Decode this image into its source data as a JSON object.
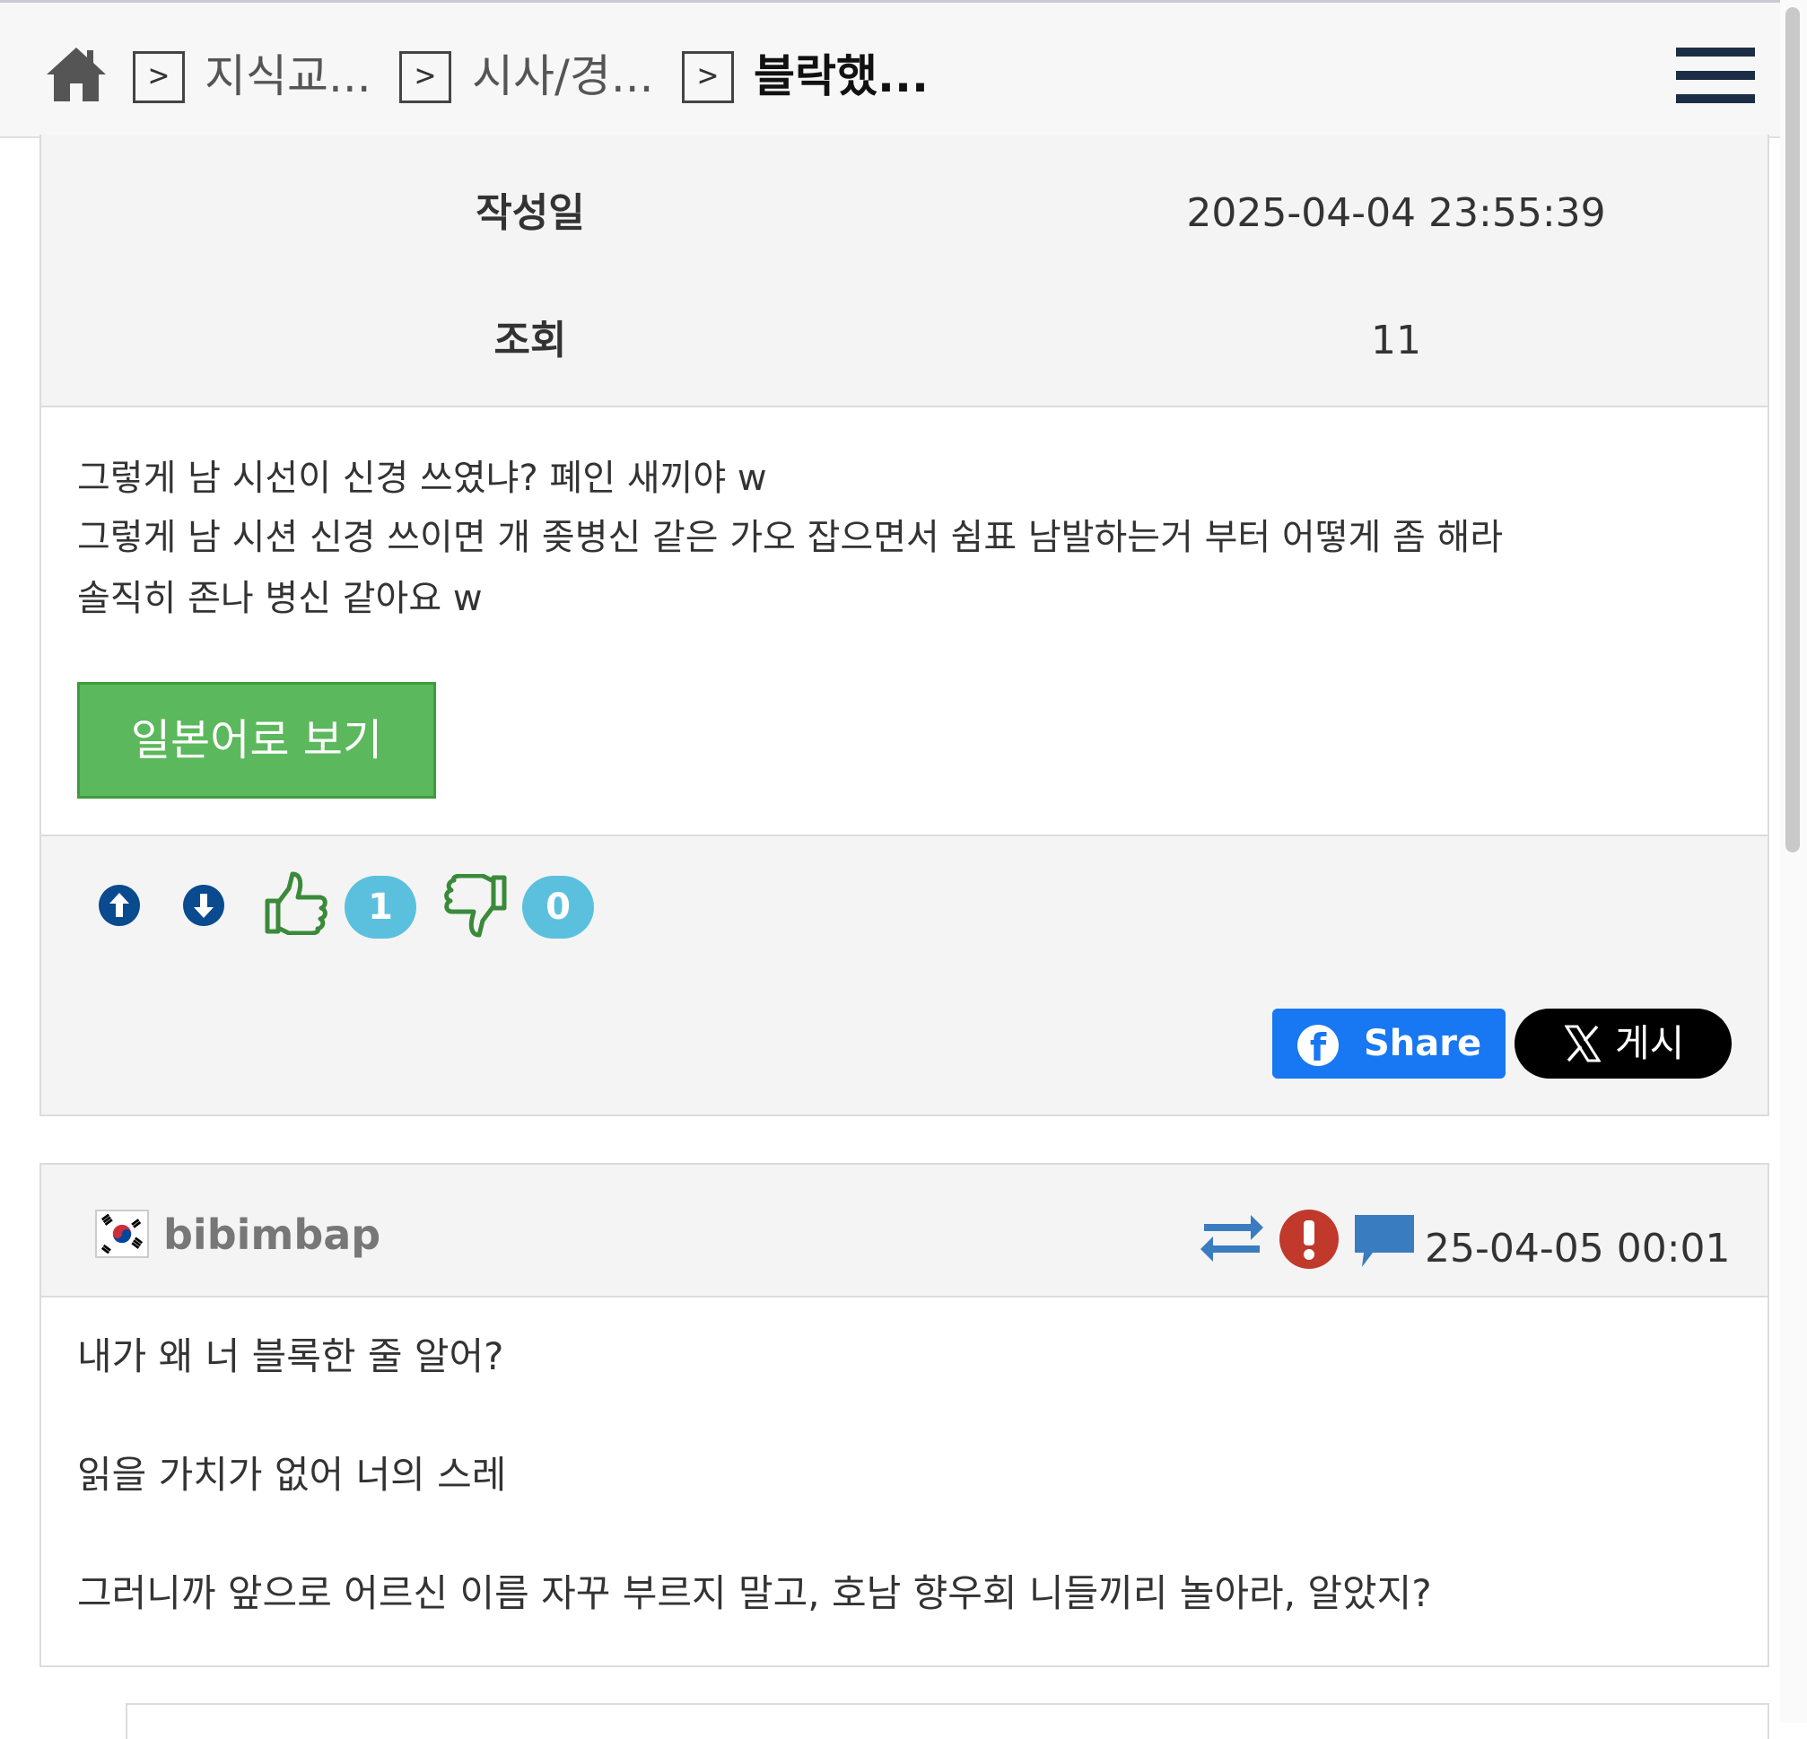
{
  "breadcrumb": {
    "items": [
      "지식교...",
      "시사/경...",
      "블락했..."
    ]
  },
  "post": {
    "meta": [
      {
        "label": "작성일",
        "value": "2025-04-04 23:55:39"
      },
      {
        "label": "조회",
        "value": "11"
      }
    ],
    "body_lines": [
      "그렇게 남 시선이 신경 쓰였냐? 폐인 새끼야 w",
      "그렇게 남 시션 신경 쓰이면 개 좆병신 같은 가오 잡으면서 쉼표 남발하는거 부터 어떻게 좀 해라",
      "솔직히 존나 병신 같아요 w"
    ],
    "translate_button": "일본어로 보기",
    "like_count": "1",
    "dislike_count": "0",
    "share_facebook": "Share",
    "share_x": "게시"
  },
  "comment": {
    "author": "bibimbap",
    "date": "25-04-05 00:01",
    "body_lines": [
      "내가 왜 너 블록한 줄 알어?",
      "",
      "읽을 가치가 없어 너의 스레",
      "",
      "그러니까 앞으로 어르신 이름 자꾸 부르지 말고, 호남 향우회 니들끼리 놀아라, 알았지?"
    ]
  },
  "colors": {
    "header_bg": "#f7f7f7",
    "icon_blue": "#0a4a8f",
    "badge_blue": "#5bc0de",
    "thumb_green": "#3a8a3a",
    "translate_green": "#5cb85c",
    "facebook_blue": "#1877f2",
    "report_red": "#c0392b",
    "comment_icon_blue": "#3a7cc0"
  },
  "icons": [
    "home-icon",
    "chevron-right-icon",
    "hamburger-menu-icon",
    "arrow-up-circle-icon",
    "arrow-down-circle-icon",
    "thumbs-up-icon",
    "thumbs-down-icon",
    "facebook-icon",
    "x-logo-icon",
    "korea-flag-icon",
    "swap-arrows-icon",
    "report-exclamation-icon",
    "reply-speech-icon"
  ]
}
